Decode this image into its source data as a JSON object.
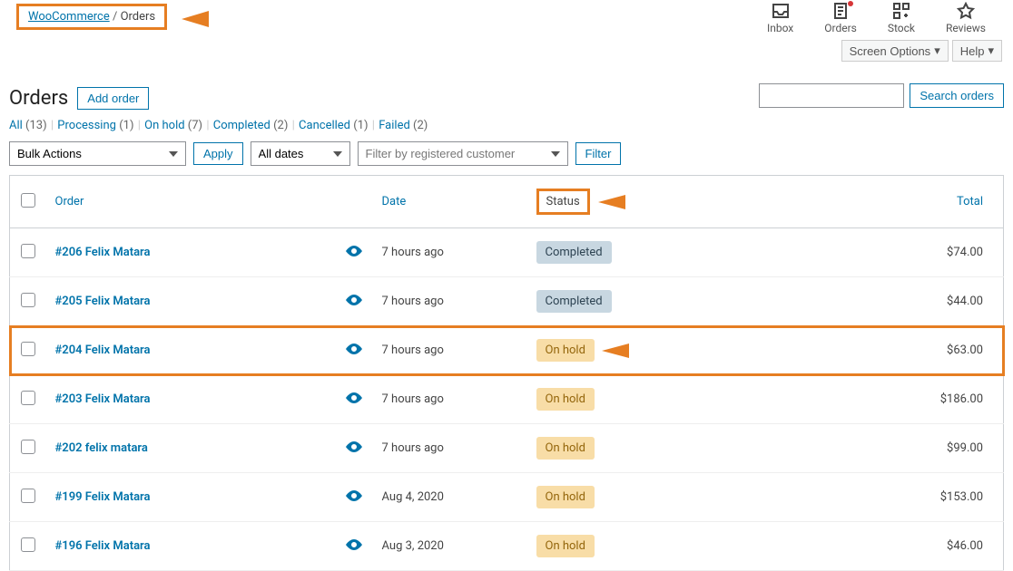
{
  "nav": {
    "inbox": "Inbox",
    "orders": "Orders",
    "stock": "Stock",
    "reviews": "Reviews"
  },
  "breadcrumb": {
    "root": "WooCommerce",
    "sep": "/",
    "current": "Orders"
  },
  "screen_options": {
    "label": "Screen Options",
    "help": "Help"
  },
  "heading": {
    "title": "Orders",
    "add": "Add order"
  },
  "filters": {
    "all": "All",
    "all_cnt": "(13)",
    "processing": "Processing",
    "processing_cnt": "(1)",
    "onhold": "On hold",
    "onhold_cnt": "(7)",
    "completed": "Completed",
    "completed_cnt": "(2)",
    "cancelled": "Cancelled",
    "cancelled_cnt": "(1)",
    "failed": "Failed",
    "failed_cnt": "(2)"
  },
  "search": {
    "button": "Search orders"
  },
  "toolbar": {
    "bulk": "Bulk Actions",
    "apply": "Apply",
    "dates": "All dates",
    "customer_placeholder": "Filter by registered customer",
    "filter": "Filter"
  },
  "columns": {
    "order": "Order",
    "date": "Date",
    "status": "Status",
    "total": "Total"
  },
  "rows": [
    {
      "order": "#206 Felix Matara",
      "date": "7 hours ago",
      "status": "Completed",
      "status_class": "s-completed",
      "total": "$74.00",
      "hl": false
    },
    {
      "order": "#205 Felix Matara",
      "date": "7 hours ago",
      "status": "Completed",
      "status_class": "s-completed",
      "total": "$44.00",
      "hl": false
    },
    {
      "order": "#204 Felix Matara",
      "date": "7 hours ago",
      "status": "On hold",
      "status_class": "s-onhold",
      "total": "$63.00",
      "hl": true
    },
    {
      "order": "#203 Felix Matara",
      "date": "7 hours ago",
      "status": "On hold",
      "status_class": "s-onhold",
      "total": "$186.00",
      "hl": false
    },
    {
      "order": "#202 felix matara",
      "date": "7 hours ago",
      "status": "On hold",
      "status_class": "s-onhold",
      "total": "$99.00",
      "hl": false
    },
    {
      "order": "#199 Felix Matara",
      "date": "Aug 4, 2020",
      "status": "On hold",
      "status_class": "s-onhold",
      "total": "$153.00",
      "hl": false
    },
    {
      "order": "#196 Felix Matara",
      "date": "Aug 3, 2020",
      "status": "On hold",
      "status_class": "s-onhold",
      "total": "$46.00",
      "hl": false
    }
  ],
  "icons": {
    "arrow_down": "▾"
  }
}
